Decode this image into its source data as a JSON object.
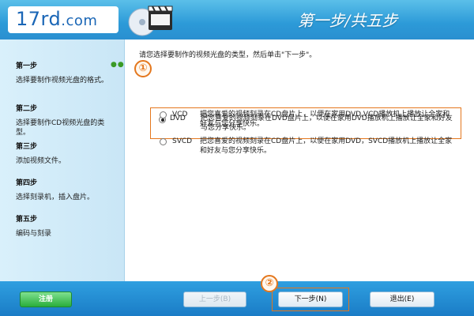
{
  "header": {
    "logo_main": "17rd",
    "logo_suffix": ".com",
    "title": "第一步/共五步",
    "icon": "video-disc-clapper-icon"
  },
  "sidebar": {
    "progress_dots": "●●●",
    "steps": [
      {
        "title": "第一步",
        "desc": "选择要制作视频光盘的格式。"
      },
      {
        "title": "第二步",
        "desc": "选择要制作CD视频光盘的类型。"
      },
      {
        "title": "第三步",
        "desc": "添加视频文件。"
      },
      {
        "title": "第四步",
        "desc": "选择刻录机，插入盘片。"
      },
      {
        "title": "第五步",
        "desc": "编码与刻录"
      }
    ]
  },
  "main": {
    "instruction": "请您选择要制作的视频光盘的类型，然后单击\"下一步\"。",
    "badge1": "①",
    "badge2": "②",
    "options": [
      {
        "label": "DVD",
        "selected": true,
        "desc": "把您喜爱的视频刻录在DVD盘片上，以便在家用DVD播放机上播放让全家和好友与您分享快乐。"
      },
      {
        "label": "VCD",
        "selected": false,
        "desc": "把您喜爱的视频刻录在CD盘片上，以便在家用DVD,VCD播放机上播放让全家和好友与您分享快乐。"
      },
      {
        "label": "SVCD",
        "selected": false,
        "desc": "把您喜爱的视频刻录在CD盘片上，以便在家用DVD，SVCD播放机上播放让全家和好友与您分享快乐。"
      }
    ]
  },
  "footer": {
    "register_label": "注册",
    "prev_label": "上一步(B)",
    "next_label": "下一步(N)",
    "exit_label": "退出(E)"
  },
  "colors": {
    "accent_orange": "#e4771d",
    "header_blue": "#2c9ad8",
    "register_green": "#2aae3c"
  }
}
